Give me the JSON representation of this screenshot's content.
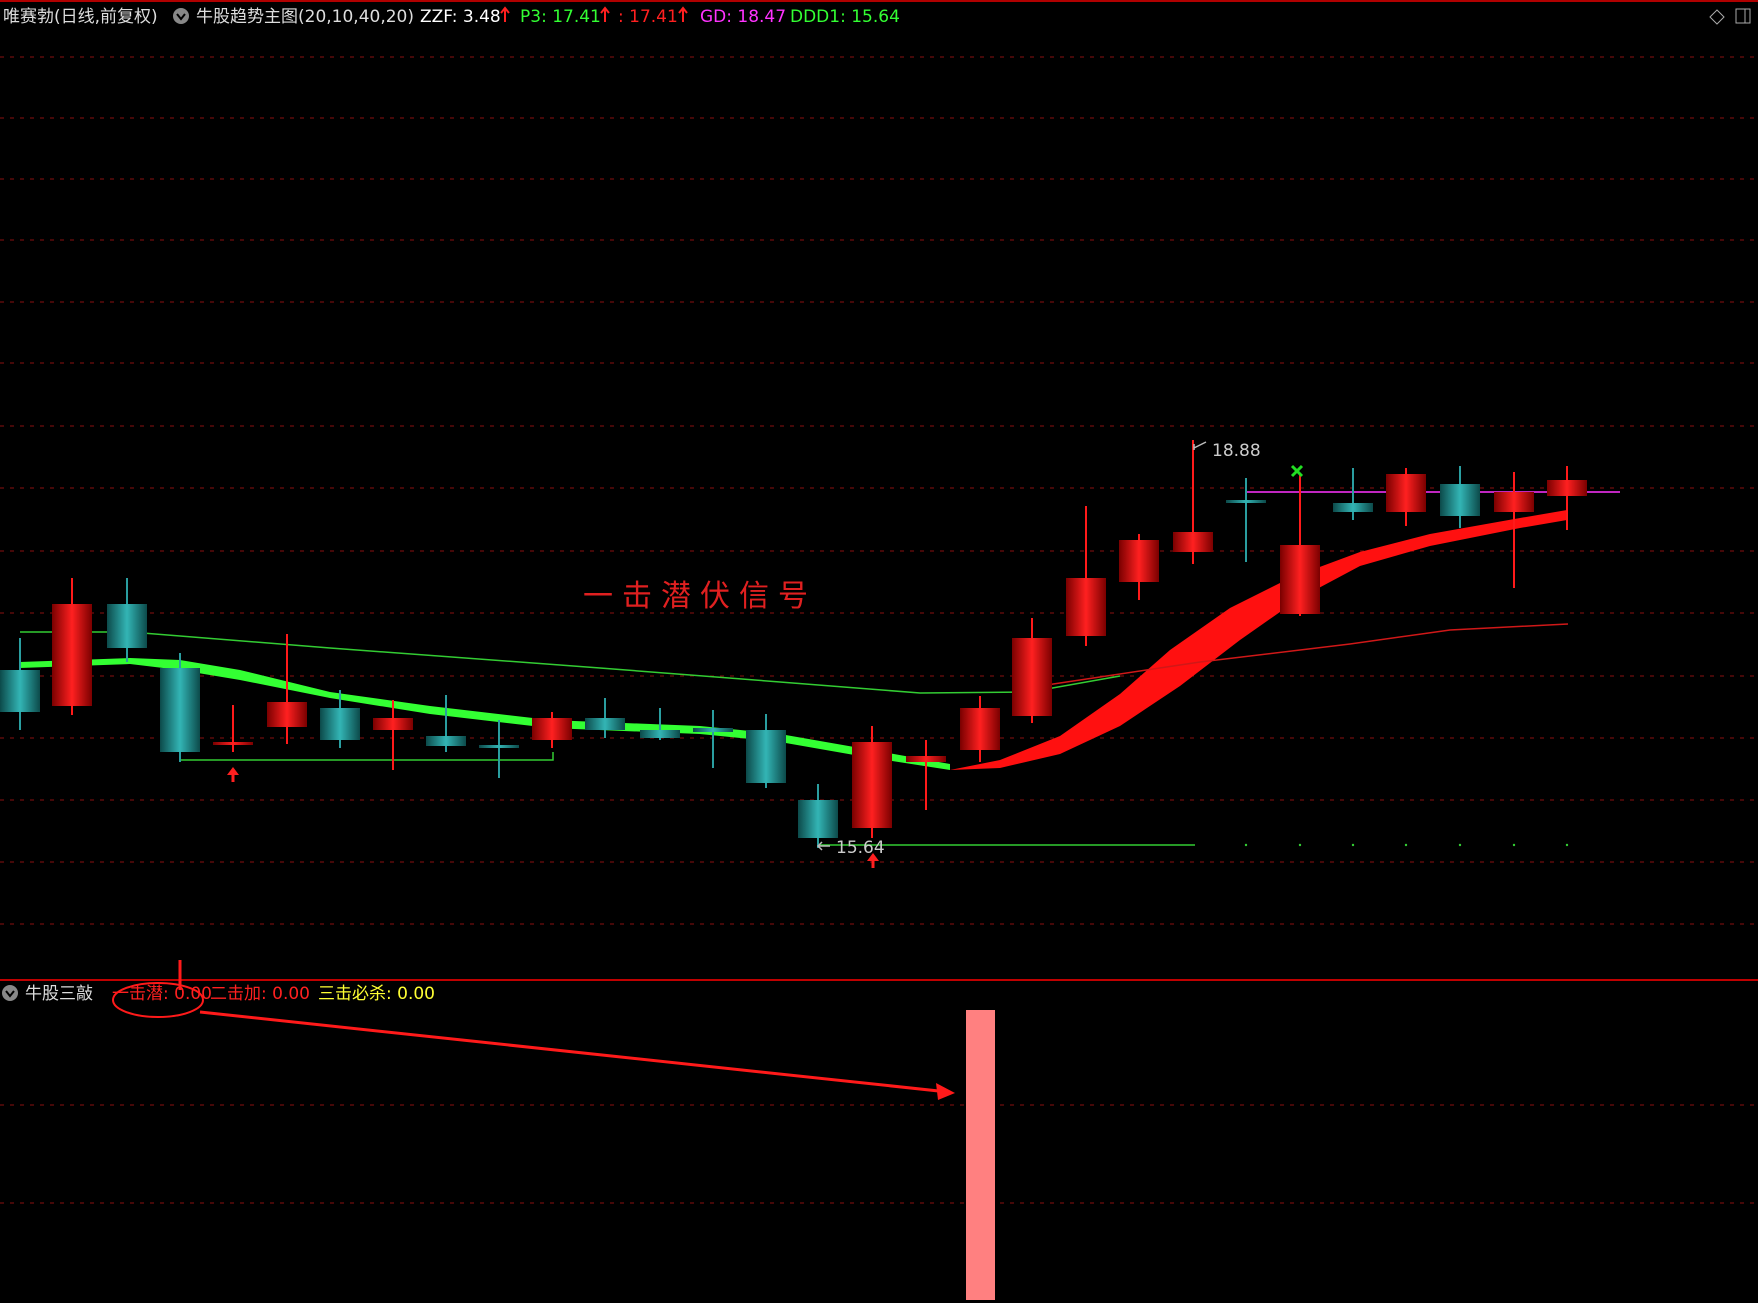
{
  "header": {
    "stock_name": "唯赛勃(日线,前复权)",
    "indicator_name": "牛股趋势主图(20,10,40,20)",
    "zzf_label": "ZZF: 3.48",
    "p3_label": "P3: 17.41",
    "p3b_label": ": 17.41",
    "gd_label": "GD: 18.47",
    "ddd1_label": "DDD1: 15.64"
  },
  "main_chart": {
    "annotation": "一击潜伏信号",
    "high_label": "18.88",
    "low_label": "15.64"
  },
  "sub_panel": {
    "name": "牛股三敲",
    "s1_label": "一击潜: 0.00",
    "s2_label": "二击加: 0.00",
    "s3_label": "三击必杀: 0.00"
  },
  "colors": {
    "background": "#000000",
    "up": "#ff1a1a",
    "down": "#2a9ea0",
    "green_band": "#33ff33",
    "magenta": "#ff33ff",
    "yellow": "#ffff33",
    "pink_bar": "#ff8080"
  }
}
